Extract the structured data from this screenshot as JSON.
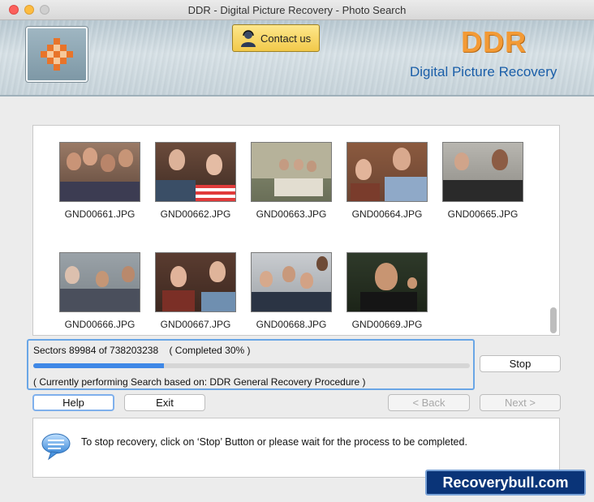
{
  "window": {
    "title": "DDR - Digital Picture Recovery - Photo Search"
  },
  "header": {
    "contact_label": "Contact us",
    "brand": "DDR",
    "subtitle": "Digital Picture Recovery",
    "brand_color": "#f39a35",
    "subtitle_color": "#1a5ea8"
  },
  "gallery": {
    "items": [
      {
        "name": "GND00661.JPG"
      },
      {
        "name": "GND00662.JPG"
      },
      {
        "name": "GND00663.JPG"
      },
      {
        "name": "GND00664.JPG"
      },
      {
        "name": "GND00665.JPG"
      },
      {
        "name": "GND00666.JPG"
      },
      {
        "name": "GND00667.JPG"
      },
      {
        "name": "GND00668.JPG"
      },
      {
        "name": "GND00669.JPG"
      }
    ]
  },
  "progress": {
    "sectors_text": "Sectors 89984 of 738203238    ( Completed 30% )",
    "percent": 30,
    "status_text": "( Currently performing Search based on: DDR General Recovery Procedure )",
    "accent": "#3f88e6"
  },
  "buttons": {
    "stop": "Stop",
    "help": "Help",
    "exit": "Exit",
    "back": "< Back",
    "next": "Next >"
  },
  "info": {
    "message": "To stop recovery, click on ‘Stop’ Button or please wait for the process to be completed.",
    "icon": "speech-bubble-icon"
  },
  "watermark": "Recoverybull.com"
}
